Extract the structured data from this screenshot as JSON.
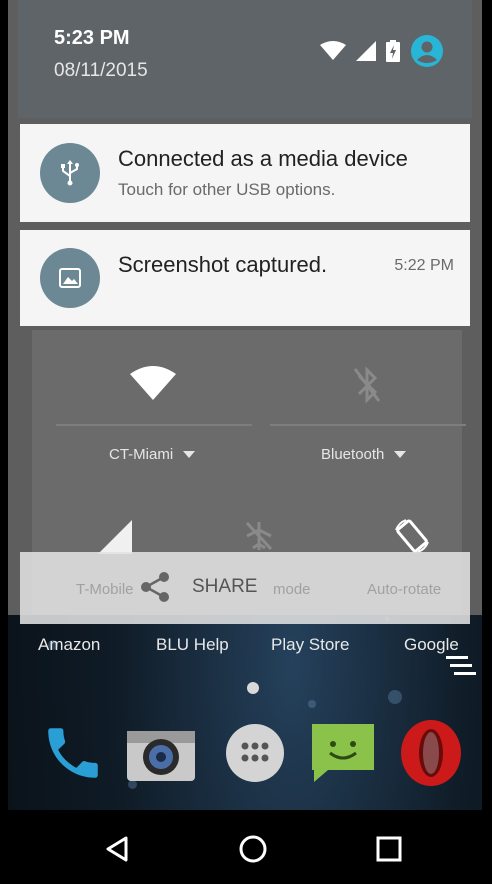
{
  "status": {
    "time": "5:23 PM",
    "date": "08/11/2015"
  },
  "notifications": [
    {
      "title": "Connected as a media device",
      "subtitle": "Touch for other USB options.",
      "icon": "usb-icon"
    },
    {
      "title": "Screenshot captured.",
      "time": "5:22 PM",
      "icon": "image-icon"
    }
  ],
  "quick_settings": {
    "wifi_label": "CT-Miami",
    "bluetooth_label": "Bluetooth",
    "mobile_label": "T-Mobile",
    "airplane_label": "mode",
    "rotate_label": "Auto-rotate"
  },
  "share": {
    "label": "SHARE"
  },
  "home": {
    "app_labels": [
      "Amazon",
      "BLU Help",
      "Play Store",
      "Google"
    ],
    "dock": [
      "phone-icon",
      "camera-icon",
      "app-drawer-icon",
      "messaging-icon",
      "opera-icon"
    ]
  },
  "colors": {
    "notif_icon_bg": "#6c8895",
    "opera_red": "#cc1a1a",
    "accent_cyan": "#29b6d6"
  }
}
